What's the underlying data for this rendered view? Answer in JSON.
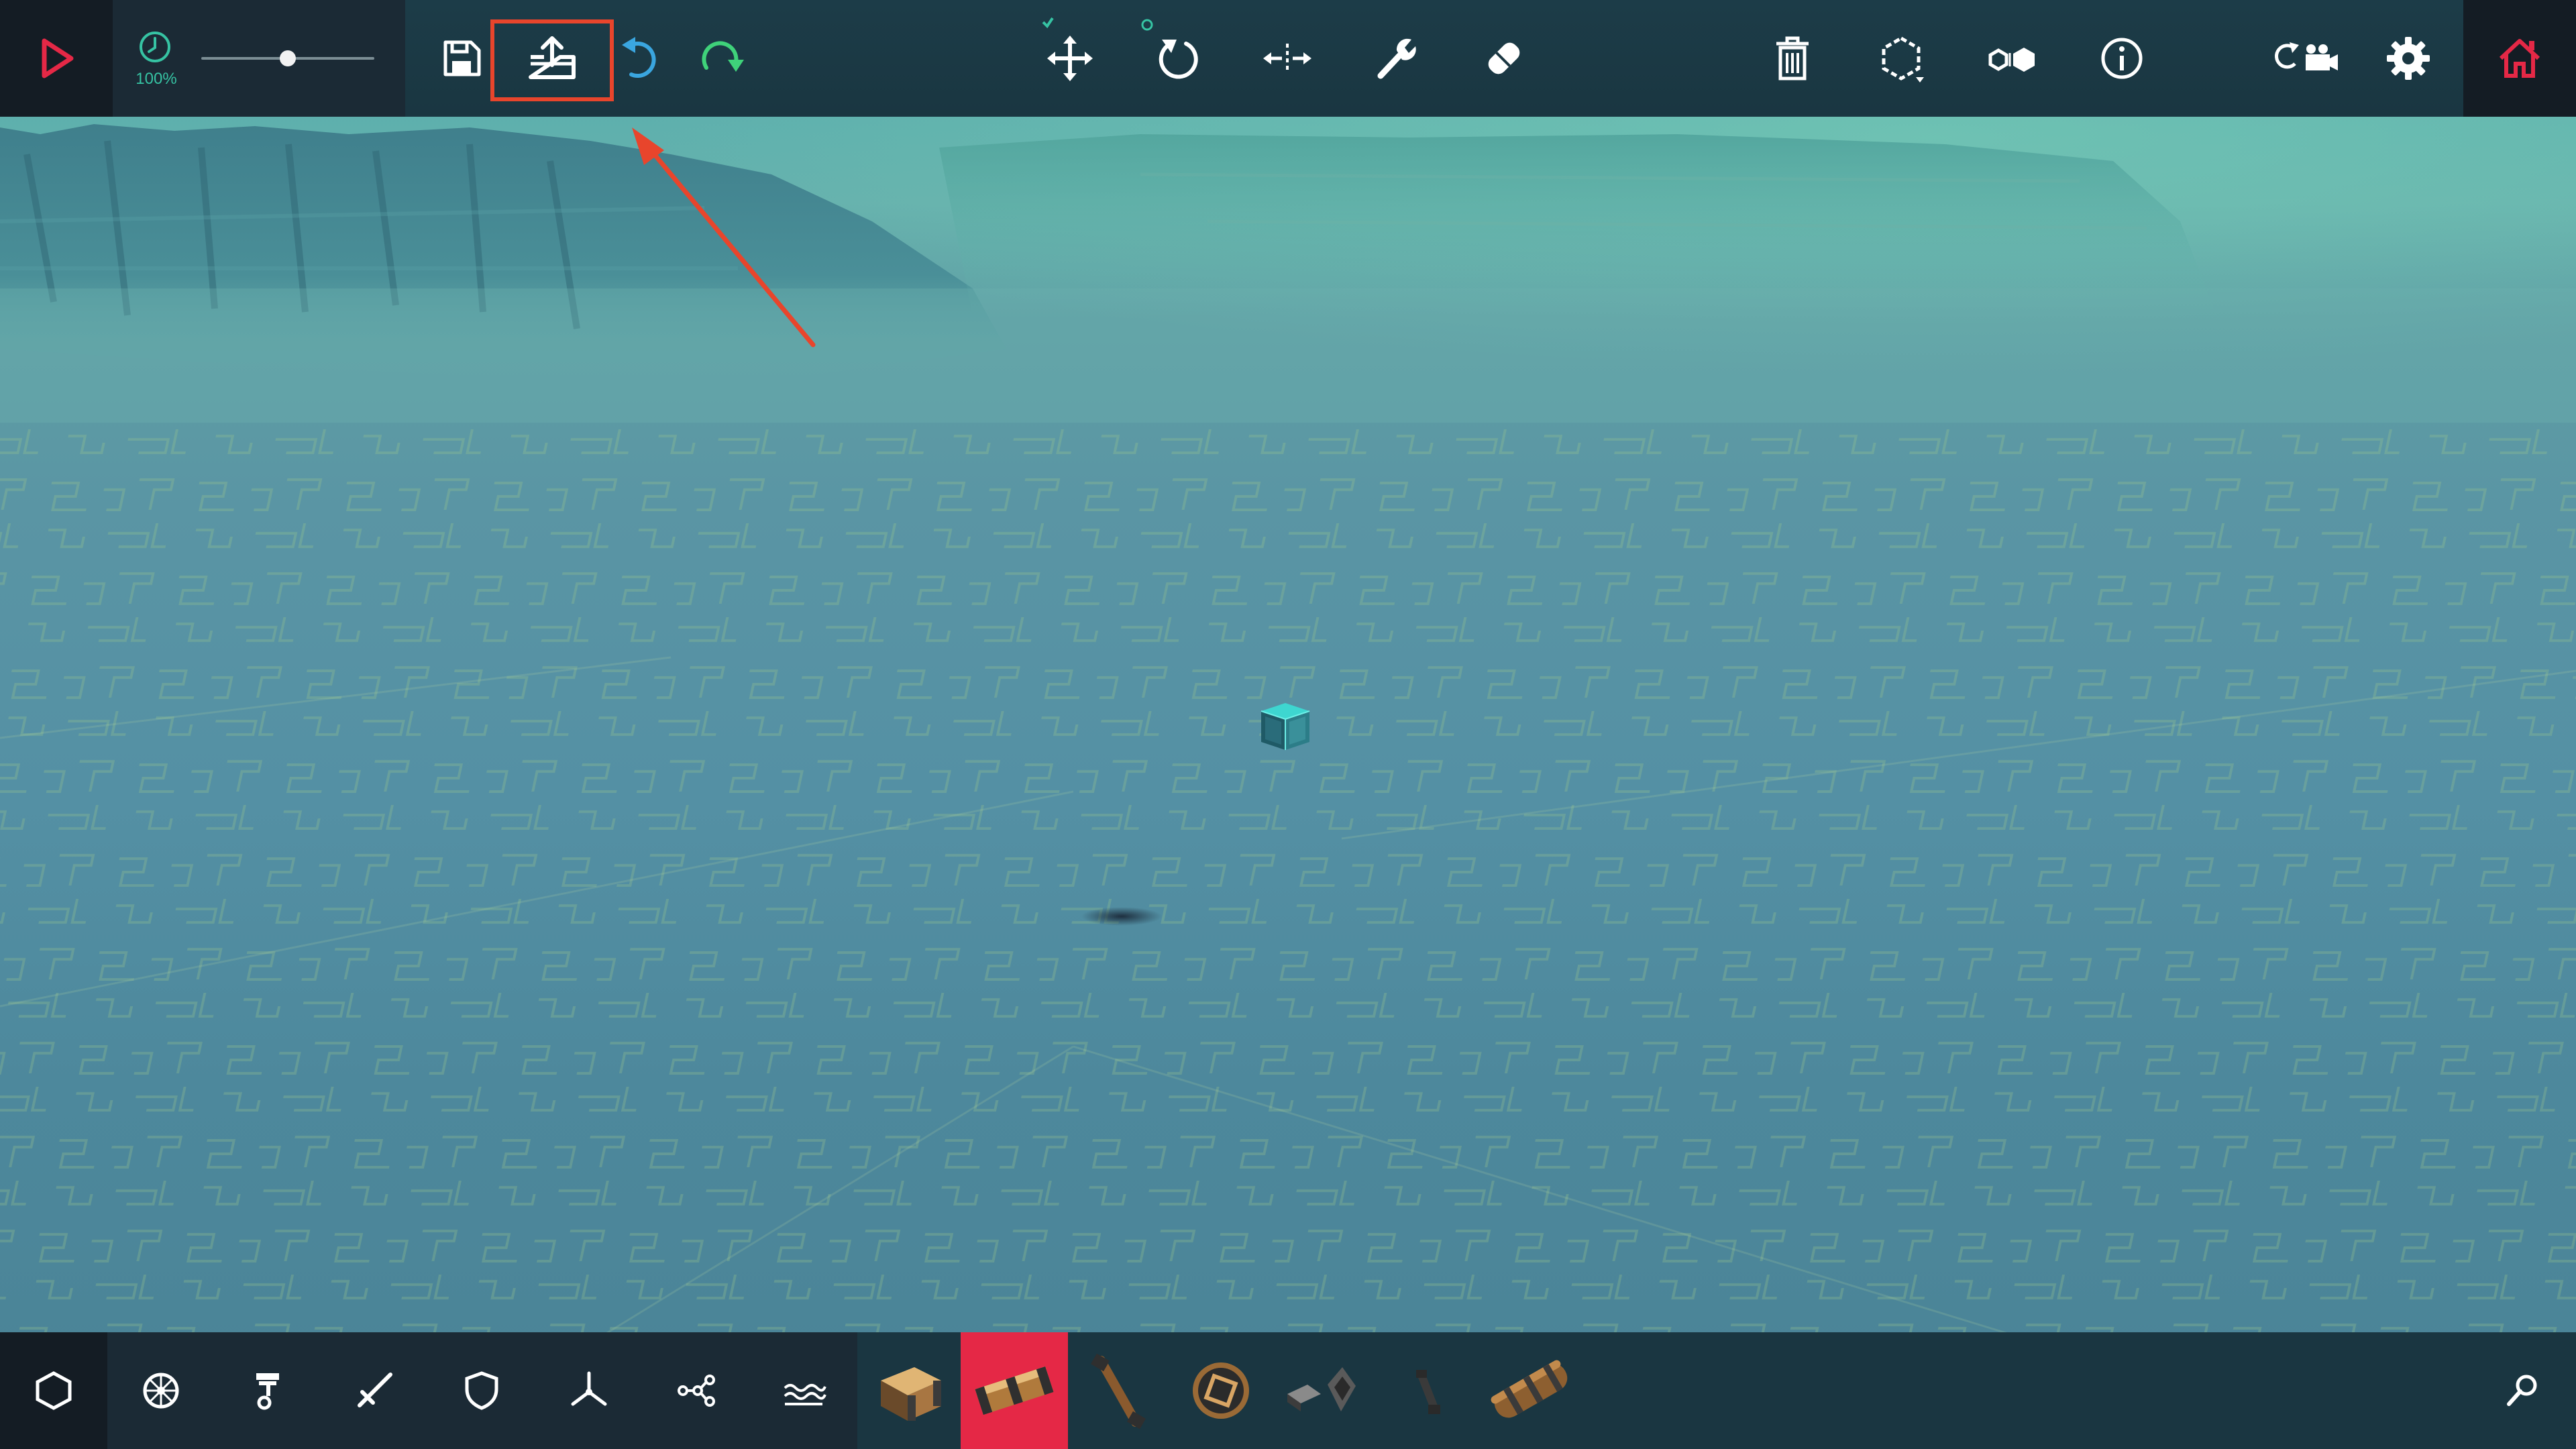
{
  "toolbar": {
    "play": {
      "icon": "play-icon",
      "color": "#e52846"
    },
    "simulation_speed": {
      "icon": "clock-icon",
      "label": "100%",
      "slider_fraction": 0.5
    },
    "buttons": [
      {
        "name": "save-button",
        "icon": "save-icon"
      },
      {
        "name": "share-button",
        "icon": "share-upload-icon",
        "highlighted": true
      },
      {
        "name": "undo-button",
        "icon": "undo-icon",
        "color": "#3aa6e0"
      },
      {
        "name": "redo-button",
        "icon": "redo-icon",
        "color": "#3fd27a"
      },
      {
        "name": "translate-button",
        "icon": "move-arrows-icon"
      },
      {
        "name": "rotate-button",
        "icon": "rotate-icon"
      },
      {
        "name": "mirror-button",
        "icon": "mirror-icon"
      },
      {
        "name": "tune-button",
        "icon": "wrench-icon"
      },
      {
        "name": "paint-button",
        "icon": "eraser-icon"
      },
      {
        "name": "delete-button",
        "icon": "trash-icon"
      },
      {
        "name": "select-mode-button",
        "icon": "hexagon-outline-icon"
      },
      {
        "name": "symmetry-button",
        "icon": "hexagon-pair-icon"
      },
      {
        "name": "info-button",
        "icon": "info-icon"
      },
      {
        "name": "camera-reset-button",
        "icon": "camera-reset-icon"
      },
      {
        "name": "settings-button",
        "icon": "gear-icon"
      },
      {
        "name": "home-button",
        "icon": "home-icon",
        "color": "#e52846"
      }
    ]
  },
  "annotation": {
    "highlight_color": "#e8452c",
    "target": "share-button"
  },
  "bottom_bar": {
    "categories": [
      {
        "name": "category-blocks",
        "icon": "hexagon-icon",
        "selected": true
      },
      {
        "name": "category-wheels",
        "icon": "wheel-icon"
      },
      {
        "name": "category-mechanical",
        "icon": "piston-icon"
      },
      {
        "name": "category-weapons",
        "icon": "sword-icon"
      },
      {
        "name": "category-armour",
        "icon": "shield-icon"
      },
      {
        "name": "category-flight",
        "icon": "propeller-icon"
      },
      {
        "name": "category-automation",
        "icon": "logic-nodes-icon"
      },
      {
        "name": "category-water",
        "icon": "water-waves-icon"
      }
    ],
    "parts": [
      {
        "name": "part-wooden-block",
        "icon": "wooden-block-icon"
      },
      {
        "name": "part-large-block",
        "icon": "large-block-icon",
        "selected": true
      },
      {
        "name": "part-pole",
        "icon": "pole-icon"
      },
      {
        "name": "part-round-block",
        "icon": "round-block-icon"
      },
      {
        "name": "part-brace",
        "icon": "brace-icon"
      },
      {
        "name": "part-small-pole",
        "icon": "small-pole-icon"
      },
      {
        "name": "part-log",
        "icon": "log-icon"
      }
    ],
    "search": {
      "icon": "search-icon"
    }
  },
  "colors": {
    "accent": "#e52846",
    "panel": "#1a3641",
    "panel_dark": "#141c24",
    "green_text": "#36c3a3"
  }
}
